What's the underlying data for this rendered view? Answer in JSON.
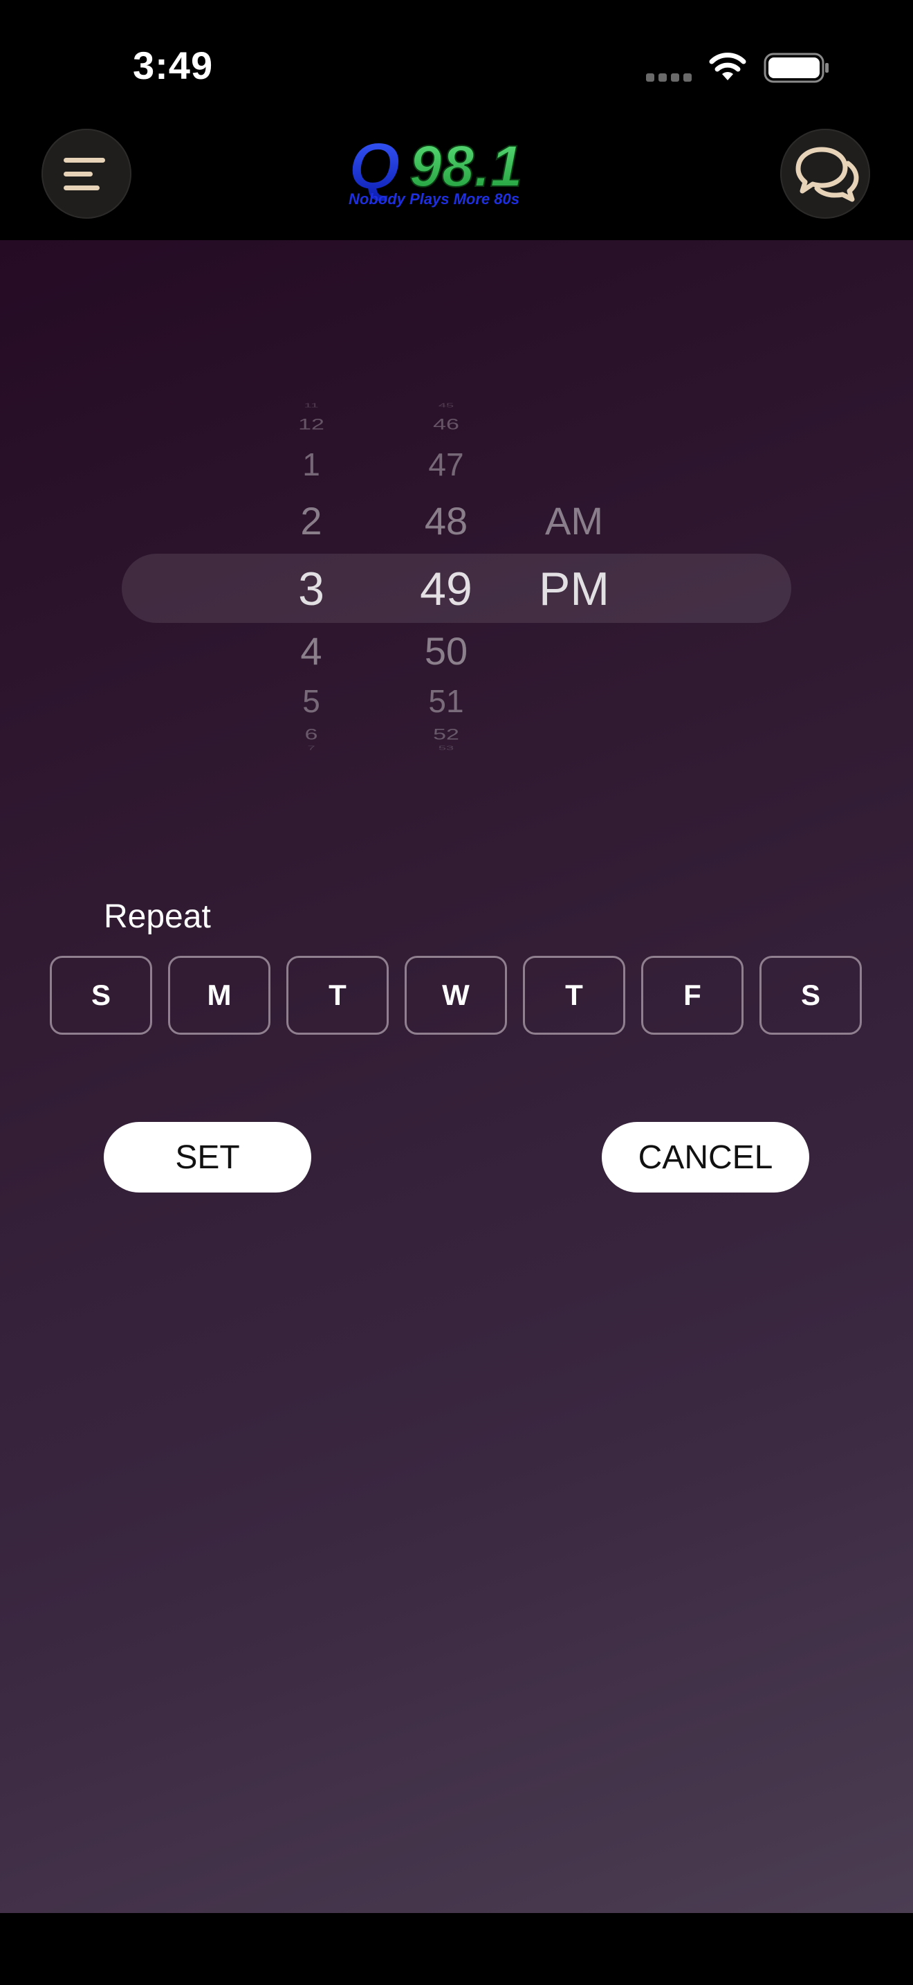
{
  "status": {
    "time": "3:49"
  },
  "header": {
    "logo_main": "Q98.1",
    "logo_tagline": "Nobody Plays More 80s",
    "menu_icon": "menu-icon",
    "chat_icon": "chat-bubbles-icon"
  },
  "picker": {
    "hours": [
      "11",
      "12",
      "1",
      "2",
      "3",
      "4",
      "5",
      "6",
      "7"
    ],
    "minutes": [
      "45",
      "46",
      "47",
      "48",
      "49",
      "50",
      "51",
      "52",
      "53"
    ],
    "ampm": [
      "AM",
      "PM"
    ],
    "selected": {
      "hour": "3",
      "minute": "49",
      "ampm": "PM"
    }
  },
  "repeat": {
    "label": "Repeat",
    "days": [
      "S",
      "M",
      "T",
      "W",
      "T",
      "F",
      "S"
    ]
  },
  "actions": {
    "set_label": "SET",
    "cancel_label": "CANCEL"
  },
  "colors": {
    "accent_beige": "#e6d3b8",
    "background_top": "#250b24",
    "background_bottom": "#4b3d52"
  }
}
